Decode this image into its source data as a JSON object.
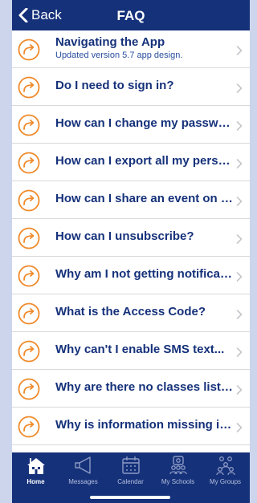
{
  "colors": {
    "navbar": "#15317a",
    "accent": "#ef8a2a",
    "tabbar": "#15317a"
  },
  "navbar": {
    "back_label": "Back",
    "title": "FAQ"
  },
  "faq": [
    {
      "question": "Navigating the App",
      "subtitle": "Updated version 5.7 app design."
    },
    {
      "question": "Do I need to sign in?"
    },
    {
      "question": "How can I change my passwo..."
    },
    {
      "question": "How can I export all my perso..."
    },
    {
      "question": "How can I share an event on F..."
    },
    {
      "question": "How can I unsubscribe?"
    },
    {
      "question": "Why am I not getting notificati..."
    },
    {
      "question": "What is the Access Code?"
    },
    {
      "question": "Why can't I enable SMS text..."
    },
    {
      "question": "Why are there no classes liste..."
    },
    {
      "question": "Why is information missing in..."
    }
  ],
  "tabs": [
    {
      "label": "Home",
      "icon": "school-icon",
      "active": true
    },
    {
      "label": "Messages",
      "icon": "megaphone-icon"
    },
    {
      "label": "Calendar",
      "icon": "calendar-icon"
    },
    {
      "label": "My Schools",
      "icon": "group-icon"
    },
    {
      "label": "My Groups",
      "icon": "groups-icon"
    }
  ]
}
